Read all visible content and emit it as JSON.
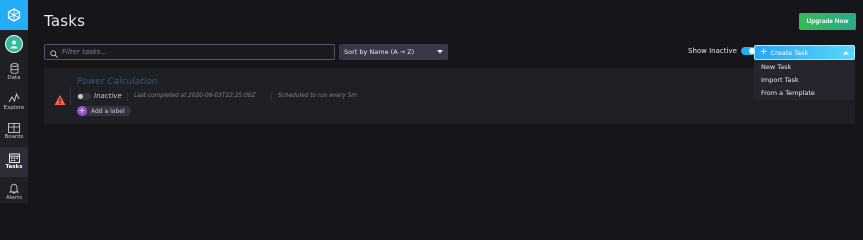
{
  "sidebar": {
    "items": [
      {
        "label": "Data",
        "icon": "database-icon"
      },
      {
        "label": "Explore",
        "icon": "graph-line-icon"
      },
      {
        "label": "Boards",
        "icon": "dashboard-grid-icon"
      },
      {
        "label": "Tasks",
        "icon": "calendar-icon"
      },
      {
        "label": "Alerts",
        "icon": "bell-icon"
      }
    ]
  },
  "header": {
    "title": "Tasks",
    "upgrade_label": "Upgrade Now"
  },
  "filters": {
    "search_placeholder": "Filter tasks...",
    "sort_value": "Sort by Name (A → Z)",
    "show_inactive_label": "Show Inactive"
  },
  "create_task": {
    "label": "Create Task",
    "menu_items": [
      "New Task",
      "Import Task",
      "From a Template"
    ]
  },
  "tasks": [
    {
      "name": "Power Calculation",
      "status": "Inactive",
      "last_completed": "Last completed at 2020-08-03T22:25:00Z",
      "schedule": "Scheduled to run every 5m",
      "add_label": "Add a label"
    }
  ],
  "colors": {
    "accent": "#22adf6",
    "upgrade_green": "#34bb55",
    "background": "#15151a",
    "card": "#1f1f26",
    "label_plus": "#9b4cd6"
  }
}
